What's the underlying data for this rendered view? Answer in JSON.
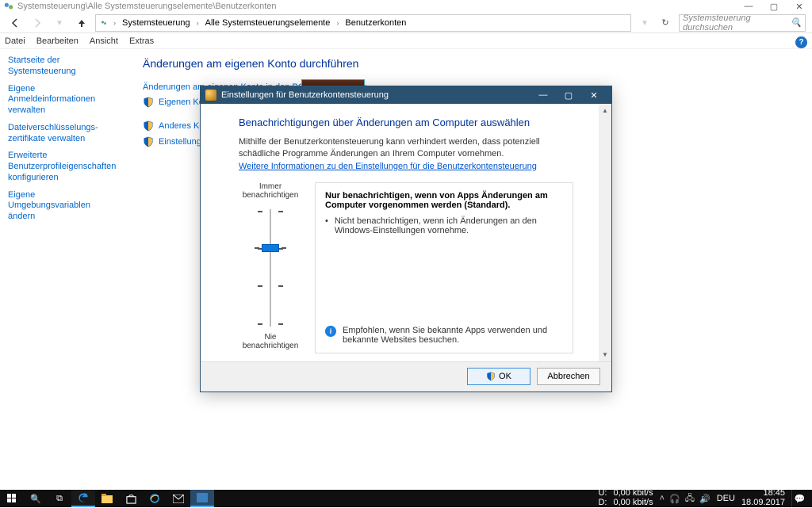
{
  "window": {
    "title": "Systemsteuerung\\Alle Systemsteuerungselemente\\Benutzerkonten"
  },
  "breadcrumb": {
    "items": [
      "Systemsteuerung",
      "Alle Systemsteuerungselemente",
      "Benutzerkonten"
    ],
    "refresh": "↻"
  },
  "search": {
    "placeholder": "Systemsteuerung durchsuchen"
  },
  "menu": {
    "datei": "Datei",
    "bearbeiten": "Bearbeiten",
    "ansicht": "Ansicht",
    "extras": "Extras"
  },
  "sidebar": {
    "home": "Startseite der Systemsteuerung",
    "creds": "Eigene Anmeldeinformationen verwalten",
    "certs": "Dateiverschlüsselungs-zertifikate verwalten",
    "advprof": "Erweiterte Benutzerprofileigenschaften konfigurieren",
    "envvars": "Eigene Umgebungsvariablen ändern"
  },
  "main": {
    "heading": "Änderungen am eigenen Konto durchführen",
    "link1": "Änderungen am eigenen Konto in den PC-Einstellungen v",
    "link2": "Eigenen Kontotyp ä",
    "link3": "Anderes Konto verw",
    "link4": "Einstellungen der Benut"
  },
  "uac": {
    "title": "Einstellungen für Benutzerkontensteuerung",
    "heading": "Benachrichtigungen über Änderungen am Computer auswählen",
    "desc": "Mithilfe der Benutzerkontensteuerung kann verhindert werden, dass potenziell schädliche Programme Änderungen an Ihrem Computer vornehmen.",
    "link": "Weitere Informationen zu den Einstellungen für die Benutzerkontensteuerung",
    "slider_top": "Immer benachrichtigen",
    "slider_bottom": "Nie benachrichtigen",
    "box_title": "Nur benachrichtigen, wenn von Apps Änderungen am Computer vorgenommen werden (Standard).",
    "box_bullet": "Nicht benachrichtigen, wenn ich Änderungen an den Windows-Einstellungen vornehme.",
    "box_info": "Empfohlen, wenn Sie bekannte Apps verwenden und bekannte Websites besuchen.",
    "ok": "OK",
    "cancel": "Abbrechen"
  },
  "taskbar": {
    "net_u": "U:",
    "net_d": "D:",
    "net_u_val": "0,00 kbit/s",
    "net_d_val": "0,00 kbit/s",
    "lang": "DEU",
    "time": "18:45",
    "date": "18.09.2017"
  }
}
